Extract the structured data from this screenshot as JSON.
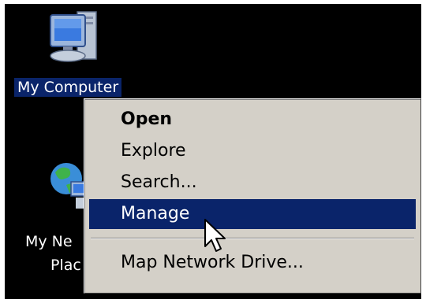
{
  "desktop": {
    "icons": [
      {
        "label": "My Computer",
        "selected": true
      },
      {
        "label_line1": "My Ne",
        "label_line2": "Plac",
        "selected": false
      }
    ]
  },
  "context_menu": {
    "items": [
      {
        "label": "Open",
        "bold": true
      },
      {
        "label": "Explore"
      },
      {
        "label": "Search..."
      },
      {
        "label": "Manage",
        "highlighted": true
      },
      {
        "label": "Map Network Drive..."
      }
    ]
  },
  "colors": {
    "desktop_bg": "#000000",
    "menu_bg": "#d4d0c8",
    "selection": "#0a246a"
  }
}
